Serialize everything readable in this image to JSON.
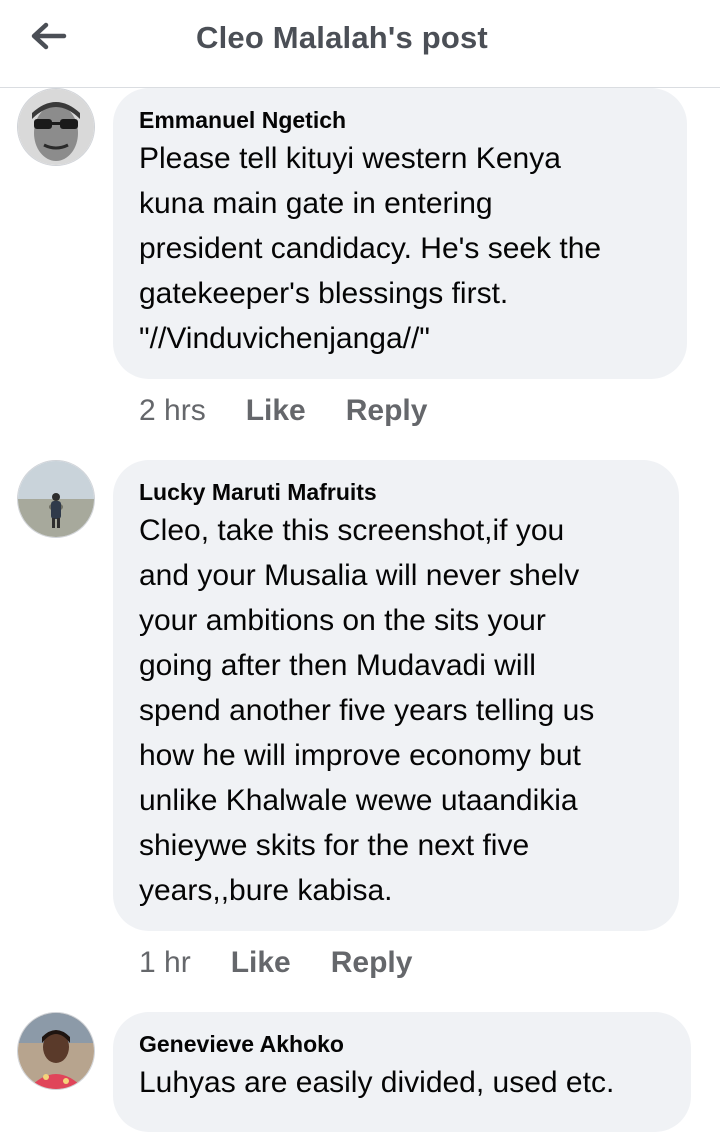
{
  "header": {
    "title": "Cleo Malalah's post",
    "back_icon": "back-arrow-icon"
  },
  "comments": [
    {
      "author": "Emmanuel Ngetich",
      "text": "Please tell kituyi western Kenya\nkuna main gate in entering\npresident candidacy. He's seek the\ngatekeeper's blessings first.\n\"//Vinduvichenjanga//\"",
      "time": "2 hrs",
      "like_label": "Like",
      "reply_label": "Reply"
    },
    {
      "author": "Lucky Maruti Mafruits",
      "text": "Cleo, take this screenshot,if you\nand your Musalia will never shelv\nyour ambitions on the sits your\ngoing after then Mudavadi will\nspend another five years telling us\nhow he will improve economy but\nunlike Khalwale wewe utaandikia\nshieywe skits for the next five\nyears,,bure kabisa.",
      "time": "1 hr",
      "like_label": "Like",
      "reply_label": "Reply"
    },
    {
      "author": "Genevieve Akhoko",
      "text": "Luhyas are easily divided, used etc."
    }
  ],
  "colors": {
    "bubble": "#f0f2f5",
    "meta_text": "#65676b",
    "title_text": "#4b4f56"
  }
}
